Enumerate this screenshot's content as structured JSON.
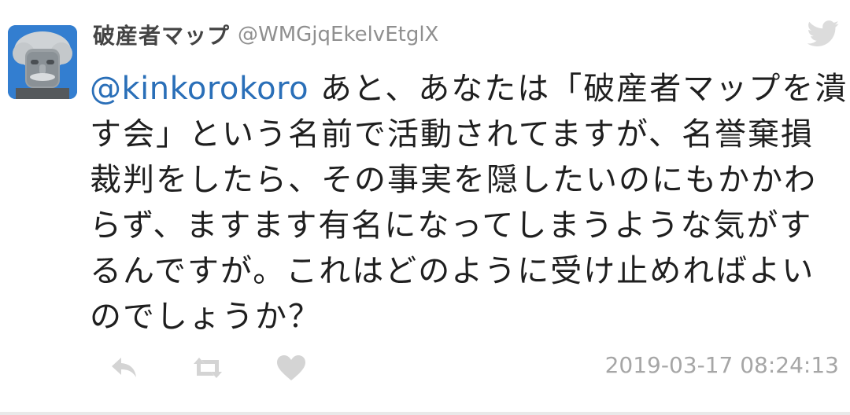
{
  "tweet": {
    "display_name": "破産者マップ",
    "handle": "@WMGjqEkelvEtglX",
    "mention": "@kinkorokoro",
    "text_lines": [
      " あと、あなたは「破産者マップを潰",
      "す会」という名前で活動されてますが、名誉棄損",
      "裁判をしたら、その事実を隠したいのにもかかわ",
      "らず、ますます有名になってしまうような気がす",
      "るんですが。これはどのように受け止めればよい",
      "のでしょうか？"
    ],
    "timestamp": "2019-03-17 08:24:13"
  },
  "icons": {
    "brand": "twitter-bird-icon",
    "reply": "reply-icon",
    "retweet": "retweet-icon",
    "like": "heart-icon"
  },
  "colors": {
    "mention": "#2a6fb8",
    "icon_gray": "#d4d4d4",
    "timestamp": "#a6a6a6"
  }
}
